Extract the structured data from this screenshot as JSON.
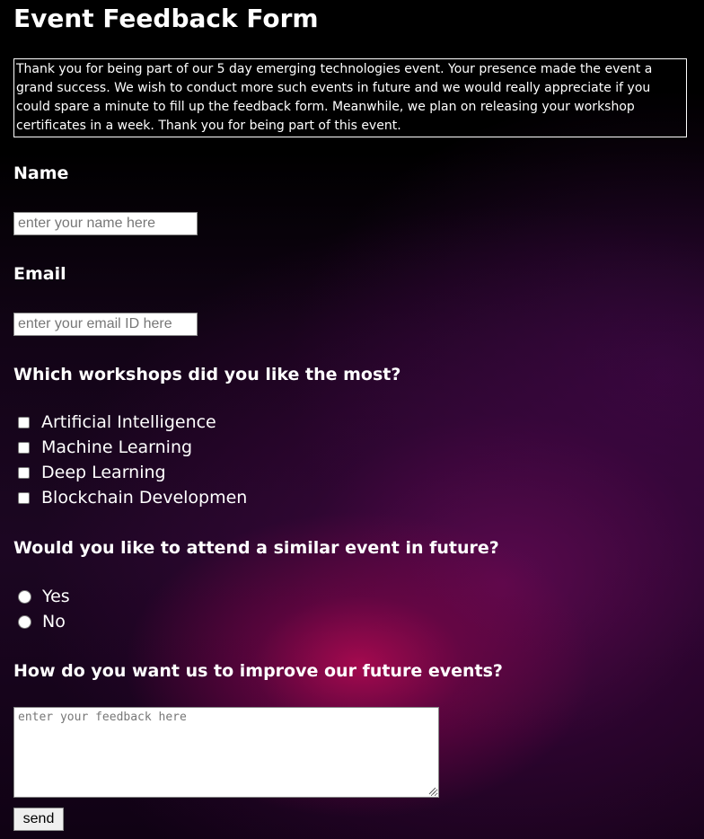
{
  "form": {
    "title": "Event Feedback Form",
    "intro": "Thank you for being part of our 5 day emerging technologies event. Your presence made the event a grand success. We wish to conduct more such events in future and we would really appreciate if you could spare a minute to fill up the feedback form. Meanwhile, we plan on releasing your workshop certificates in a week. Thank you for being part of this event.",
    "name": {
      "label": "Name",
      "placeholder": "enter your name here",
      "value": ""
    },
    "email": {
      "label": "Email",
      "placeholder": "enter your email ID here",
      "value": ""
    },
    "workshops": {
      "question": "Which workshops did you like the most?",
      "options": [
        {
          "label": "Artificial Intelligence",
          "checked": false
        },
        {
          "label": "Machine Learning",
          "checked": false
        },
        {
          "label": "Deep Learning",
          "checked": false
        },
        {
          "label": "Blockchain Developmen",
          "checked": false
        }
      ]
    },
    "attend_again": {
      "question": "Would you like to attend a similar event in future?",
      "options": [
        {
          "label": "Yes",
          "selected": false
        },
        {
          "label": "No",
          "selected": false
        }
      ]
    },
    "improve": {
      "question": "How do you want us to improve our future events?",
      "placeholder": "enter your feedback here",
      "value": ""
    },
    "submit_label": "send"
  },
  "colors": {
    "text": "#ffffff",
    "background": "#000000",
    "accent_glow": "#a00a50"
  }
}
